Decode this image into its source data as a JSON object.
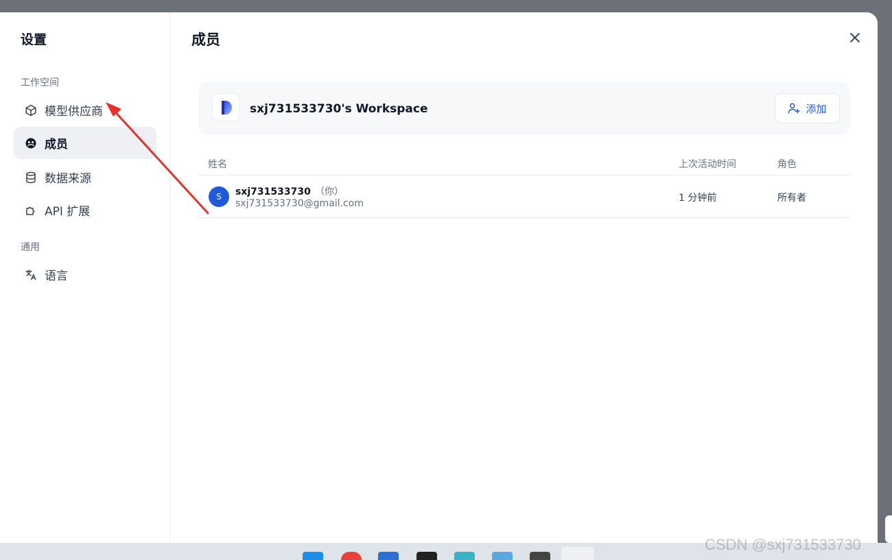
{
  "sidebar": {
    "title": "设置",
    "groups": [
      {
        "label": "工作空间"
      },
      {
        "label": "通用"
      }
    ],
    "items": [
      {
        "label": "模型供应商",
        "icon": "cube-icon"
      },
      {
        "label": "成员",
        "icon": "members-icon",
        "active": true
      },
      {
        "label": "数据来源",
        "icon": "database-icon"
      },
      {
        "label": "API 扩展",
        "icon": "puzzle-icon"
      },
      {
        "label": "语言",
        "icon": "translate-icon"
      }
    ]
  },
  "main": {
    "title": "成员",
    "workspace": {
      "name": "sxj731533730's Workspace",
      "add_label": "添加"
    },
    "table": {
      "headers": [
        "姓名",
        "上次活动时间",
        "角色"
      ],
      "rows": [
        {
          "avatar": "S",
          "name": "sxj731533730",
          "you": "（你）",
          "email": "sxj731533730@gmail.com",
          "last_active": "1 分钟前",
          "role": "所有者"
        }
      ]
    }
  },
  "watermark": "CSDN @sxj731533730",
  "colors": {
    "accent": "#1d5bd8",
    "annotation_arrow": "#e8312a",
    "backdrop": "#6b7079"
  }
}
